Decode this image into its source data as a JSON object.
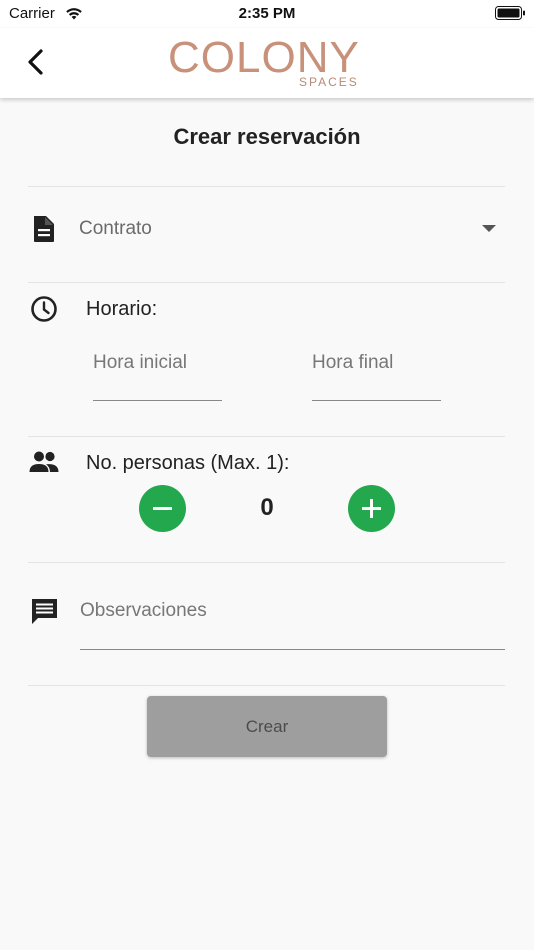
{
  "status_bar": {
    "carrier": "Carrier",
    "time": "2:35 PM"
  },
  "navbar": {
    "logo_main": "COLONY",
    "logo_sub": "SPACES"
  },
  "page": {
    "title": "Crear reservación"
  },
  "form": {
    "contract": {
      "placeholder": "Contrato"
    },
    "schedule": {
      "label": "Horario:",
      "start_placeholder": "Hora inicial",
      "end_placeholder": "Hora final"
    },
    "people": {
      "label": "No. personas (Max. 1):",
      "count": "0"
    },
    "observations": {
      "placeholder": "Observaciones"
    },
    "submit_label": "Crear"
  },
  "colors": {
    "accent_green": "#23a84d",
    "logo": "#c7917a",
    "disabled_button": "#9e9e9e"
  },
  "icons": {
    "back": "chevron-left-icon",
    "contract": "document-icon",
    "schedule": "clock-icon",
    "people": "people-icon",
    "observations": "comment-icon",
    "dropdown": "dropdown-arrow-icon",
    "decrement": "minus-icon",
    "increment": "plus-icon"
  }
}
